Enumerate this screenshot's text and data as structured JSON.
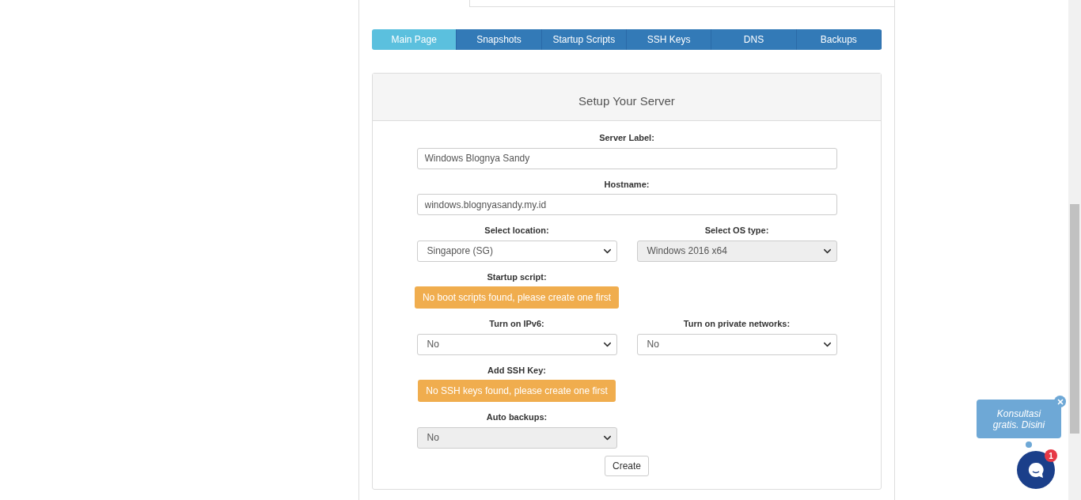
{
  "tabs": [
    {
      "label": "Main Page",
      "selected": true
    },
    {
      "label": "Snapshots",
      "selected": false
    },
    {
      "label": "Startup Scripts",
      "selected": false
    },
    {
      "label": "SSH Keys",
      "selected": false
    },
    {
      "label": "DNS",
      "selected": false
    },
    {
      "label": "Backups",
      "selected": false
    }
  ],
  "panel": {
    "title": "Setup Your Server",
    "rows": [
      {
        "fields": [
          {
            "kind": "input",
            "label": "Server Label:",
            "value": "Windows Blognya Sandy"
          }
        ]
      },
      {
        "fields": [
          {
            "kind": "input",
            "label": "Hostname:",
            "value": "windows.blognyasandy.my.id"
          }
        ]
      },
      {
        "fields": [
          {
            "kind": "select",
            "label": "Select location:",
            "value": "Singapore (SG)",
            "disabled": false
          },
          {
            "kind": "select",
            "label": "Select OS type:",
            "value": "Windows 2016 x64",
            "disabled": true
          }
        ]
      },
      {
        "fields": [
          {
            "kind": "alert",
            "label": "Startup script:",
            "value": "No boot scripts found, please create one first"
          }
        ]
      },
      {
        "fields": [
          {
            "kind": "select",
            "label": "Turn on IPv6:",
            "value": "No",
            "disabled": false
          },
          {
            "kind": "select",
            "label": "Turn on private networks:",
            "value": "No",
            "disabled": false
          }
        ]
      },
      {
        "fields": [
          {
            "kind": "alert",
            "label": "Add SSH Key:",
            "value": "No SSH keys found, please create one first"
          }
        ]
      },
      {
        "fields": [
          {
            "kind": "select",
            "label": "Auto backups:",
            "value": "No",
            "disabled": true
          }
        ]
      }
    ],
    "button": "Create"
  },
  "chat": {
    "bubble": "Konsultasi gratis. Disini",
    "badge": "1"
  }
}
